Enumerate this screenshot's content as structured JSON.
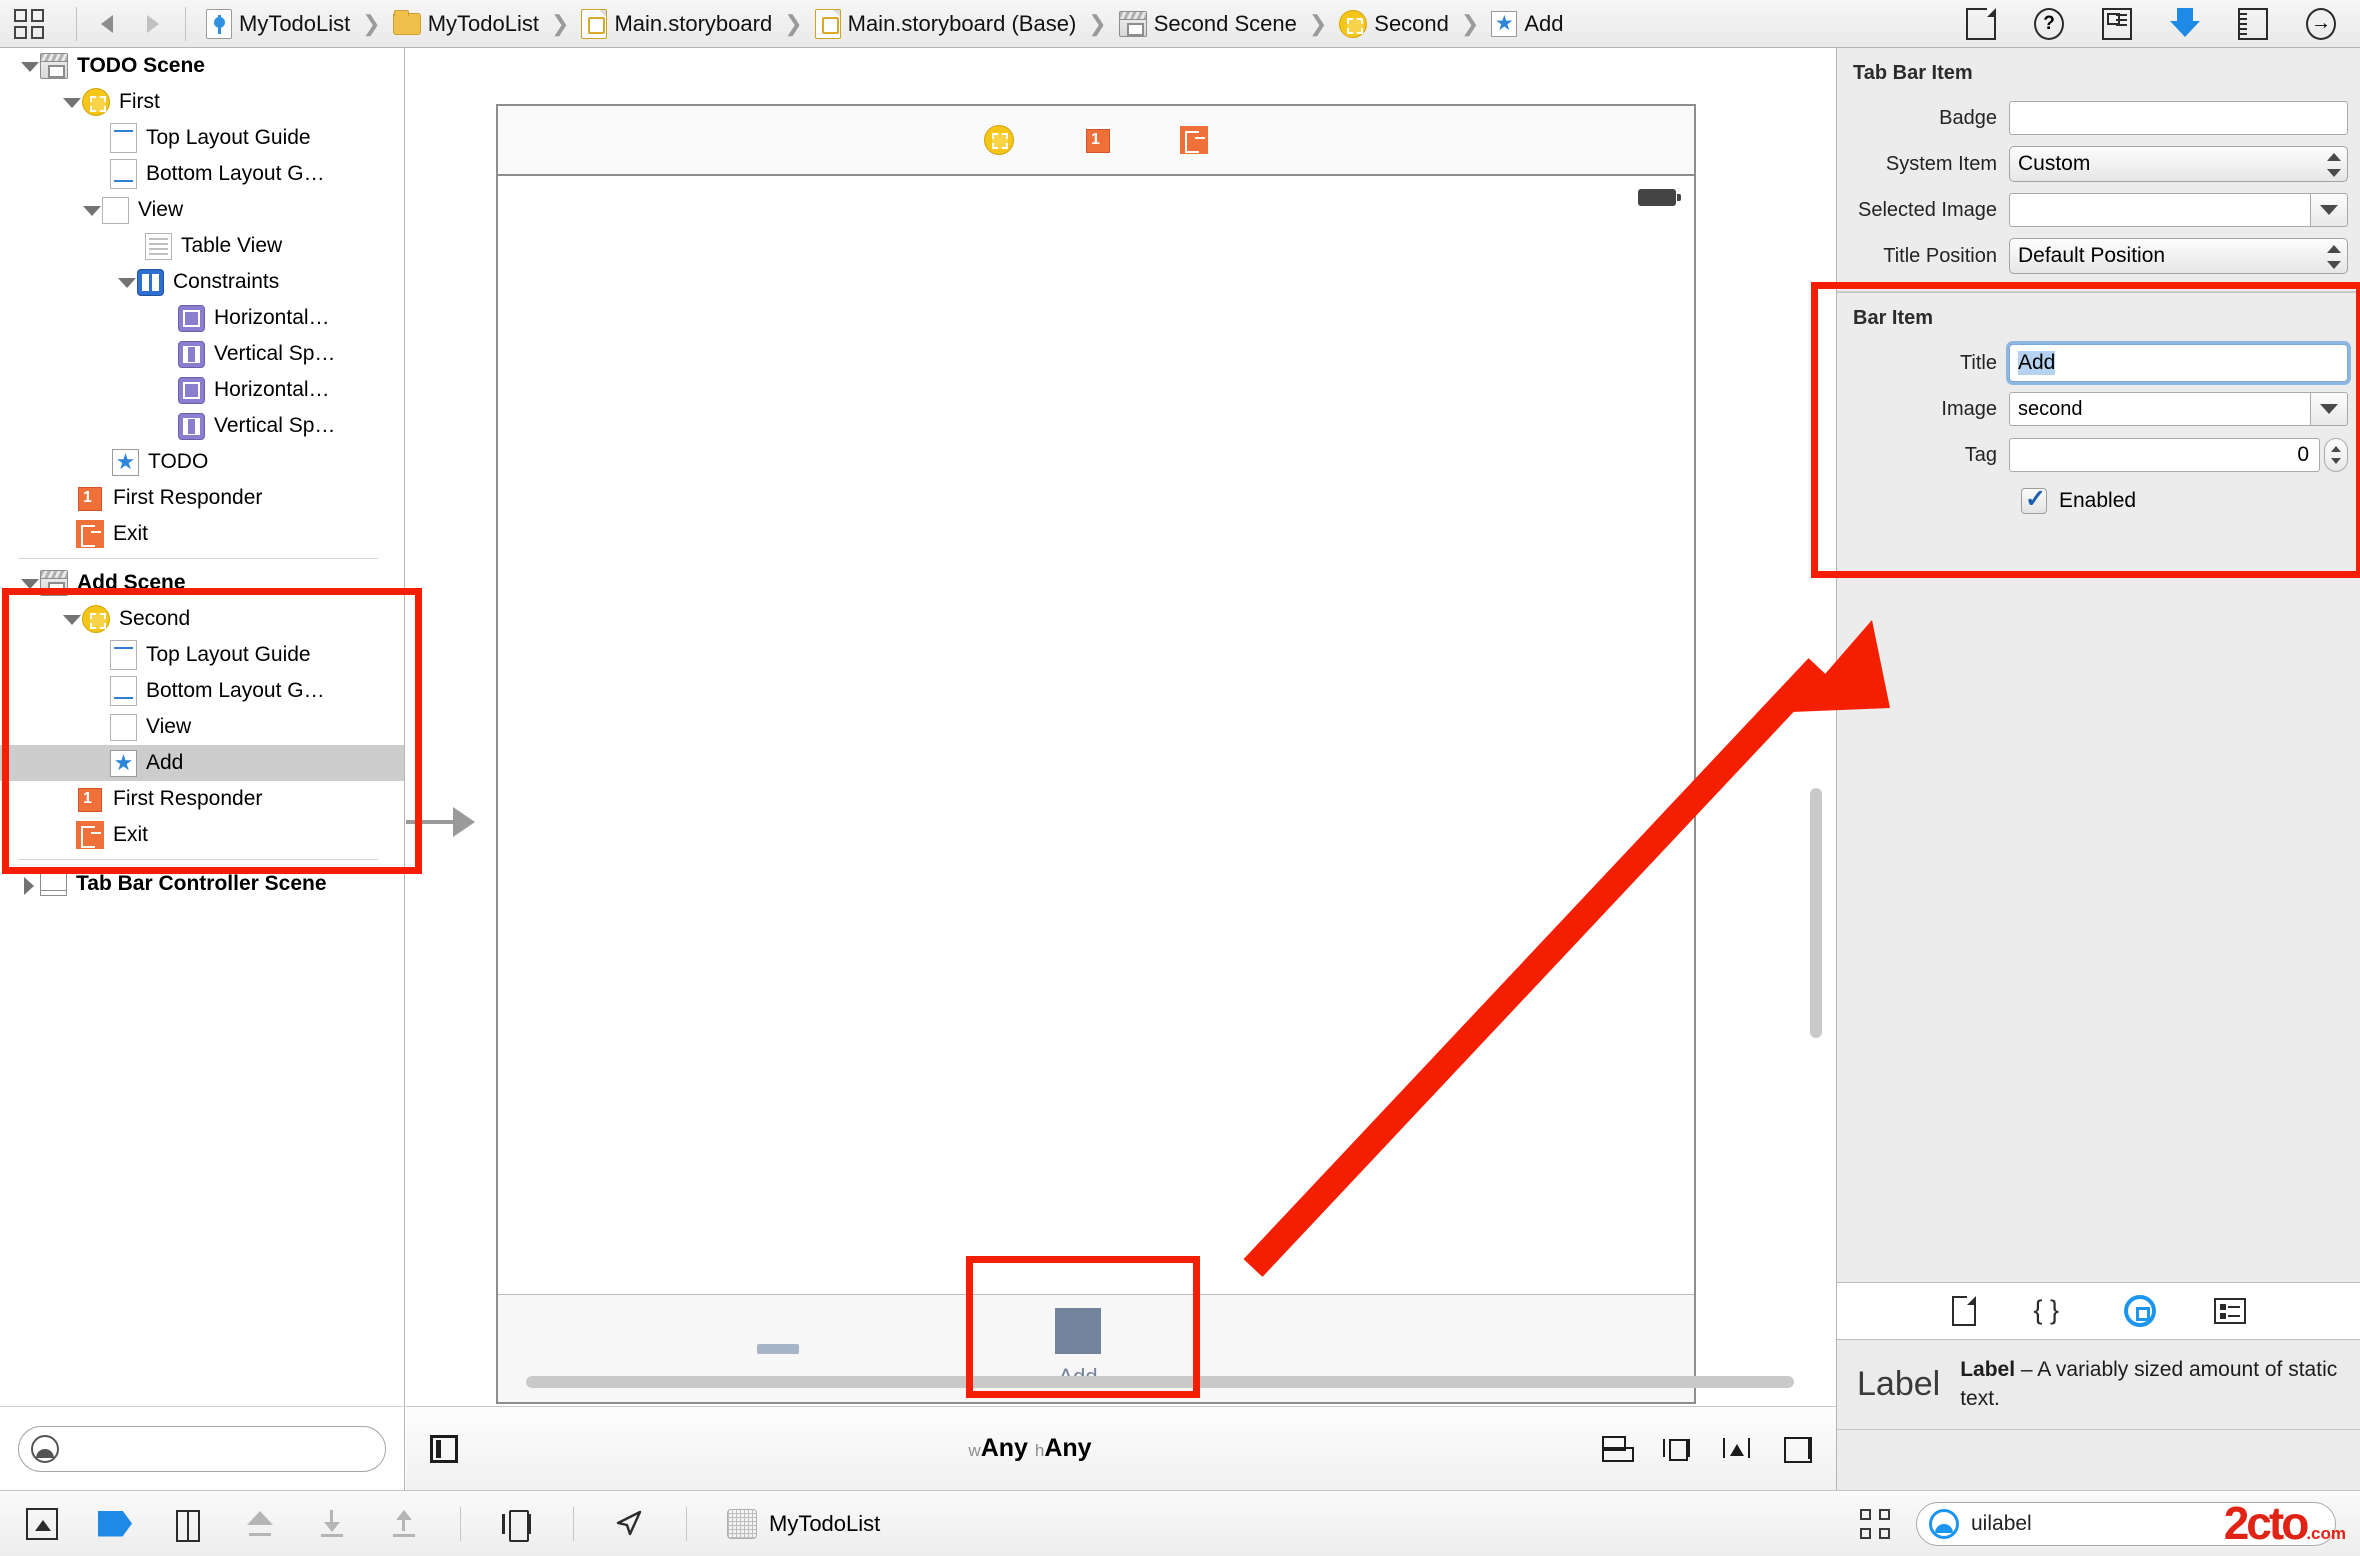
{
  "titlebar": {
    "breadcrumbs": [
      {
        "icon": "project-icon",
        "label": "MyTodoList"
      },
      {
        "icon": "folder-icon",
        "label": "MyTodoList"
      },
      {
        "icon": "storyboard-icon",
        "label": "Main.storyboard"
      },
      {
        "icon": "storyboard-icon",
        "label": "Main.storyboard (Base)"
      },
      {
        "icon": "scene-icon",
        "label": "Second Scene"
      },
      {
        "icon": "view-controller-icon",
        "label": "Second"
      },
      {
        "icon": "bar-item-icon",
        "label": "Add"
      }
    ],
    "right_icons": [
      "file-inspector-icon",
      "quick-help-icon",
      "identity-inspector-icon",
      "attributes-inspector-icon",
      "size-inspector-icon",
      "connections-inspector-icon"
    ]
  },
  "outline": {
    "rows": [
      {
        "label": "TODO Scene",
        "indent": 0,
        "icon": "scene-icon",
        "disclosure": "open",
        "bold": true,
        "selected": false
      },
      {
        "label": "First",
        "indent": 1,
        "icon": "view-controller-icon",
        "disclosure": "open",
        "bold": false,
        "selected": false
      },
      {
        "label": "Top Layout Guide",
        "indent": 2,
        "icon": "top-layout-guide-icon",
        "disclosure": "none",
        "bold": false,
        "selected": false
      },
      {
        "label": "Bottom Layout G…",
        "indent": 2,
        "icon": "bottom-layout-guide-icon",
        "disclosure": "none",
        "bold": false,
        "selected": false
      },
      {
        "label": "View",
        "indent": 2,
        "icon": "view-icon",
        "disclosure": "open",
        "bold": false,
        "selected": false
      },
      {
        "label": "Table View",
        "indent": 3,
        "icon": "table-view-icon",
        "disclosure": "none",
        "bold": false,
        "selected": false
      },
      {
        "label": "Constraints",
        "indent": 3,
        "icon": "constraints-icon",
        "disclosure": "open",
        "bold": false,
        "selected": false
      },
      {
        "label": "Horizontal…",
        "indent": 4,
        "icon": "horizontal-constraint-icon",
        "disclosure": "none",
        "bold": false,
        "selected": false
      },
      {
        "label": "Vertical Sp…",
        "indent": 4,
        "icon": "vertical-constraint-icon",
        "disclosure": "none",
        "bold": false,
        "selected": false
      },
      {
        "label": "Horizontal…",
        "indent": 4,
        "icon": "horizontal-constraint-icon",
        "disclosure": "none",
        "bold": false,
        "selected": false
      },
      {
        "label": "Vertical Sp…",
        "indent": 4,
        "icon": "vertical-constraint-icon",
        "disclosure": "none",
        "bold": false,
        "selected": false
      },
      {
        "label": "TODO",
        "indent": 3,
        "icon": "bar-item-icon",
        "disclosure": "none",
        "bold": false,
        "selected": false
      },
      {
        "label": "First Responder",
        "indent": 2,
        "icon": "first-responder-icon",
        "disclosure": "none",
        "bold": false,
        "selected": false
      },
      {
        "label": "Exit",
        "indent": 2,
        "icon": "exit-icon",
        "disclosure": "none",
        "bold": false,
        "selected": false
      },
      {
        "label": "Add Scene",
        "indent": 0,
        "icon": "scene-icon",
        "disclosure": "open",
        "bold": true,
        "selected": false
      },
      {
        "label": "Second",
        "indent": 1,
        "icon": "view-controller-icon",
        "disclosure": "open",
        "bold": false,
        "selected": false
      },
      {
        "label": "Top Layout Guide",
        "indent": 2,
        "icon": "top-layout-guide-icon",
        "disclosure": "none",
        "bold": false,
        "selected": false
      },
      {
        "label": "Bottom Layout G…",
        "indent": 2,
        "icon": "bottom-layout-guide-icon",
        "disclosure": "none",
        "bold": false,
        "selected": false
      },
      {
        "label": "View",
        "indent": 2,
        "icon": "view-icon",
        "disclosure": "none",
        "bold": false,
        "selected": false
      },
      {
        "label": "Add",
        "indent": 2,
        "icon": "bar-item-icon",
        "disclosure": "none",
        "bold": false,
        "selected": true
      },
      {
        "label": "First Responder",
        "indent": 2,
        "icon": "first-responder-icon",
        "disclosure": "none",
        "bold": false,
        "selected": false
      },
      {
        "label": "Exit",
        "indent": 2,
        "icon": "exit-icon",
        "disclosure": "none",
        "bold": false,
        "selected": false
      },
      {
        "label": "Tab Bar Controller Scene",
        "indent": 0,
        "icon": "tab-bar-controller-icon",
        "disclosure": "closed",
        "bold": true,
        "selected": false
      }
    ],
    "filter_placeholder": ""
  },
  "canvas": {
    "dock_icons": [
      "view-controller-icon",
      "first-responder-icon",
      "exit-icon"
    ],
    "tabbar": {
      "first_tab_label": "",
      "second_tab_label": "Add"
    },
    "bottombar": {
      "size_class_w_prefix": "w",
      "size_class_w": "Any",
      "size_class_h_prefix": "h",
      "size_class_h": "Any"
    }
  },
  "inspector": {
    "tab_bar_item": {
      "section_title": "Tab Bar Item",
      "badge_label": "Badge",
      "badge_value": "",
      "system_item_label": "System Item",
      "system_item_value": "Custom",
      "selected_image_label": "Selected Image",
      "selected_image_value": "",
      "title_position_label": "Title Position",
      "title_position_value": "Default Position"
    },
    "bar_item": {
      "section_title": "Bar Item",
      "title_label": "Title",
      "title_value": "Add",
      "image_label": "Image",
      "image_value": "second",
      "tag_label": "Tag",
      "tag_value": "0",
      "enabled_label": "Enabled",
      "enabled_checked": true
    },
    "library_tabs": [
      "file-template-library-icon",
      "code-snippet-library-icon",
      "object-library-icon",
      "media-library-icon"
    ],
    "description": {
      "preview_text": "Label",
      "title": "Label",
      "body": " – A variably sized amount of static text."
    }
  },
  "bottombar": {
    "project_name": "MyTodoList",
    "search_value": "uilabel",
    "watermark": "2cto",
    "watermark_suffix": ".com"
  },
  "colors": {
    "annotation_red": "#f41f00",
    "accent_blue": "#1c95ef",
    "selection_gray": "#cdcdcd",
    "tab_icon_gray": "#73839c"
  }
}
